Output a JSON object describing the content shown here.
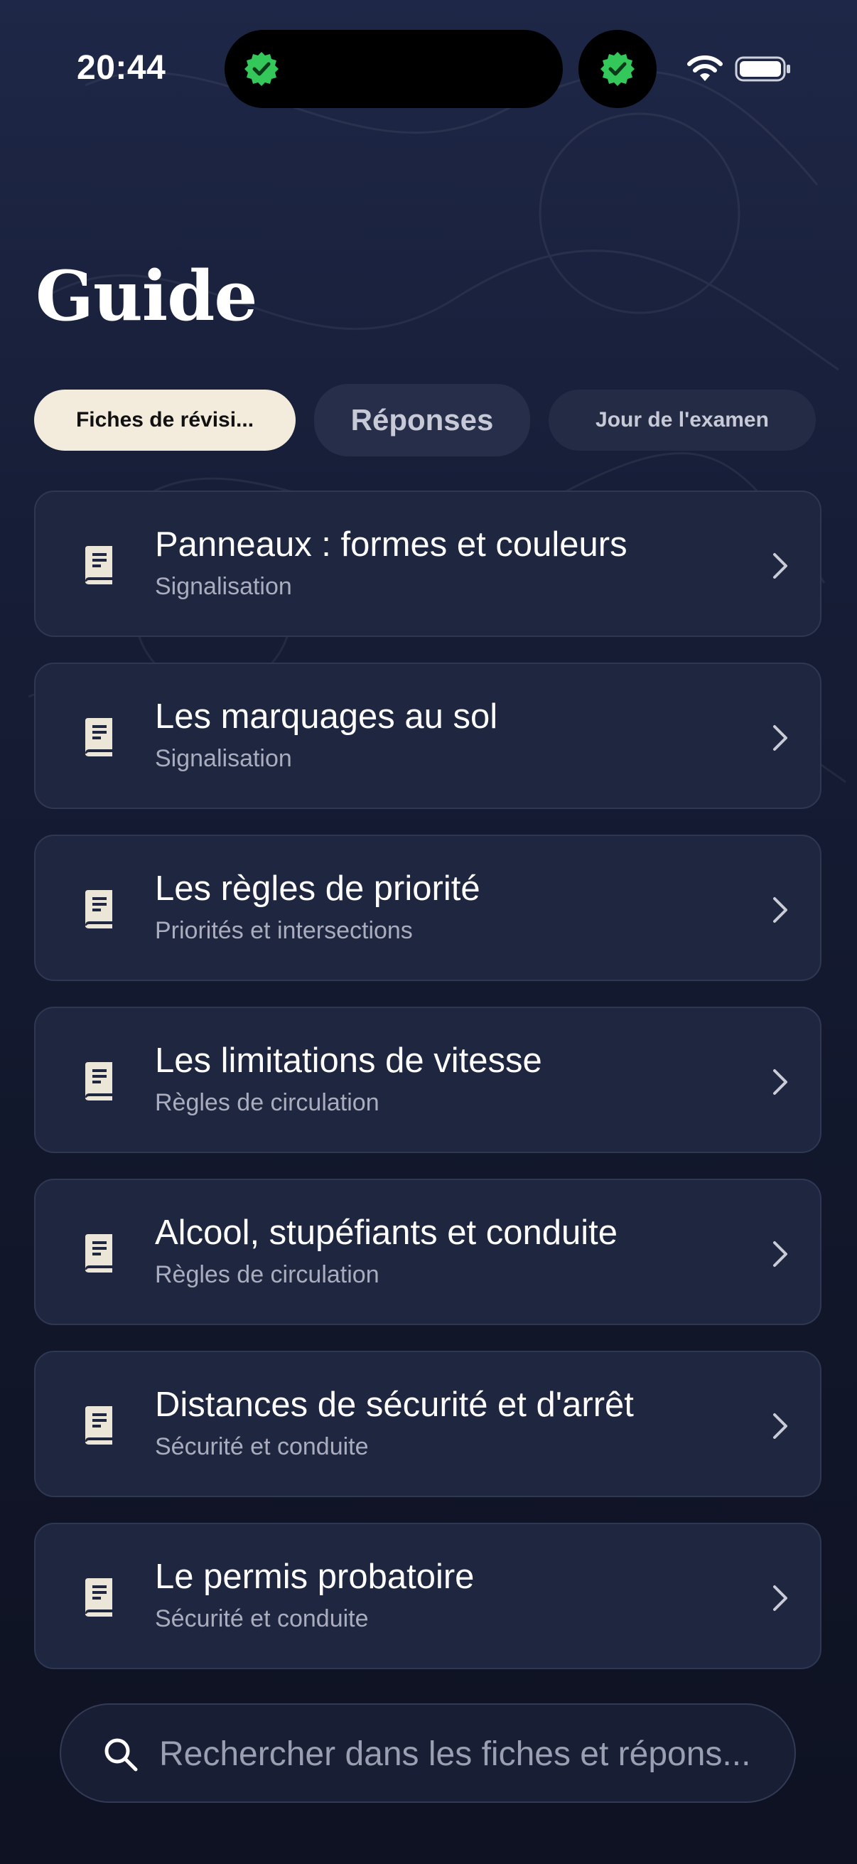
{
  "status_bar": {
    "time": "20:44",
    "icons": [
      "verified-badge-icon",
      "verified-badge-icon",
      "wifi-icon",
      "battery-icon"
    ]
  },
  "header": {
    "title": "Guide"
  },
  "tabs": [
    {
      "label": "Fiches de révisi...",
      "active": true
    },
    {
      "label": "Réponses",
      "active": false
    },
    {
      "label": "Jour de l'examen",
      "active": false
    }
  ],
  "items": [
    {
      "title": "Panneaux : formes et couleurs",
      "subtitle": "Signalisation",
      "icon": "book-icon"
    },
    {
      "title": "Les marquages au sol",
      "subtitle": "Signalisation",
      "icon": "book-icon"
    },
    {
      "title": "Les règles de priorité",
      "subtitle": "Priorités et intersections",
      "icon": "book-icon"
    },
    {
      "title": "Les limitations de vitesse",
      "subtitle": "Règles de circulation",
      "icon": "book-icon"
    },
    {
      "title": "Alcool, stupéfiants et conduite",
      "subtitle": "Règles de circulation",
      "icon": "book-icon"
    },
    {
      "title": "Distances de sécurité et d'arrêt",
      "subtitle": "Sécurité et conduite",
      "icon": "book-icon"
    },
    {
      "title": "Le permis probatoire",
      "subtitle": "Sécurité et conduite",
      "icon": "book-icon"
    }
  ],
  "search": {
    "placeholder": "Rechercher dans les fiches et répons..."
  },
  "colors": {
    "background": "#141a30",
    "card": "#1f2640",
    "active_tab": "#f3ecdd",
    "verified": "#34c759"
  }
}
